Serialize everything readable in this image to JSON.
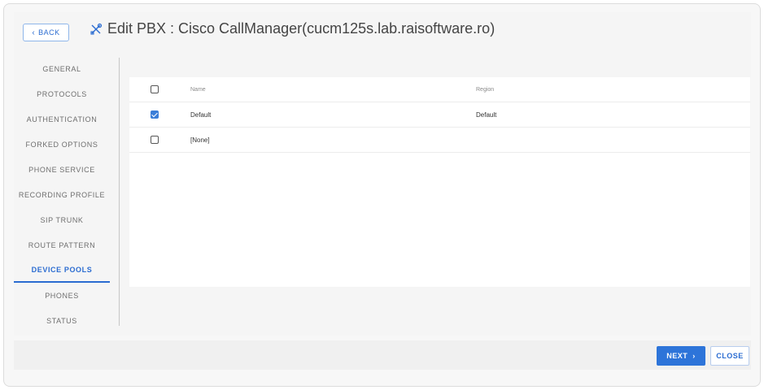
{
  "header": {
    "back_label": "BACK",
    "back_icon": "chevron-left-icon",
    "title_icon": "tools-icon",
    "title": "Edit PBX : Cisco CallManager(cucm125s.lab.raisoftware.ro)"
  },
  "sidebar": {
    "items": [
      {
        "label": "GENERAL"
      },
      {
        "label": "PROTOCOLS"
      },
      {
        "label": "AUTHENTICATION"
      },
      {
        "label": "FORKED OPTIONS"
      },
      {
        "label": "PHONE SERVICE"
      },
      {
        "label": "RECORDING PROFILE"
      },
      {
        "label": "SIP TRUNK"
      },
      {
        "label": "ROUTE PATTERN"
      },
      {
        "label": "DEVICE POOLS",
        "active": true
      },
      {
        "label": "PHONES"
      },
      {
        "label": "STATUS"
      }
    ]
  },
  "table": {
    "columns": {
      "name": "Name",
      "region": "Region"
    },
    "rows": [
      {
        "name": "Default",
        "region": "Default",
        "checked": true
      },
      {
        "name": "[None]",
        "region": "",
        "checked": false
      }
    ]
  },
  "footer": {
    "next_label": "NEXT",
    "next_icon": "chevron-right-icon",
    "close_label": "CLOSE"
  },
  "colors": {
    "accent": "#2b6cd1",
    "primary_button": "#2d74d9"
  }
}
